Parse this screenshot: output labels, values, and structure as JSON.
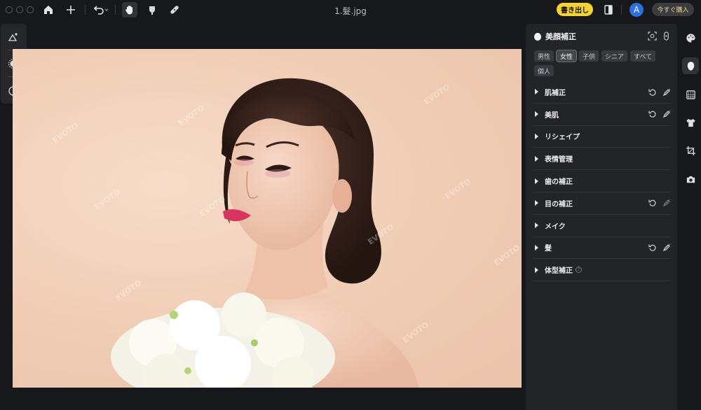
{
  "window": {
    "title": "1.髮.jpg"
  },
  "toolbar": {
    "export_label": "書き出し",
    "avatar_letter": "A",
    "buy_label": "今すぐ購入"
  },
  "watermark": {
    "text": "EVOTO"
  },
  "panel": {
    "title": "美顔補正",
    "chips": [
      "男性",
      "女性",
      "子供",
      "シニア",
      "すべて",
      "個人"
    ],
    "active_chip": "女性",
    "rows": [
      {
        "label": "肌補正",
        "reset": true,
        "edit": true
      },
      {
        "label": "美肌",
        "reset": true,
        "edit": true
      },
      {
        "label": "リシェイプ",
        "reset": false,
        "edit": false
      },
      {
        "label": "表情管理",
        "reset": false,
        "edit": false
      },
      {
        "label": "歯の補正",
        "reset": false,
        "edit": false
      },
      {
        "label": "目の補正",
        "reset": true,
        "edit": true
      },
      {
        "label": "メイク",
        "reset": false,
        "edit": false
      },
      {
        "label": "髮",
        "reset": true,
        "edit": true
      },
      {
        "label": "体型補正",
        "reset": false,
        "edit": false,
        "info": true
      }
    ]
  },
  "colors": {
    "accent_yellow": "#f6d233",
    "avatar_blue": "#2f6fe0",
    "panel_bg": "#222428"
  }
}
